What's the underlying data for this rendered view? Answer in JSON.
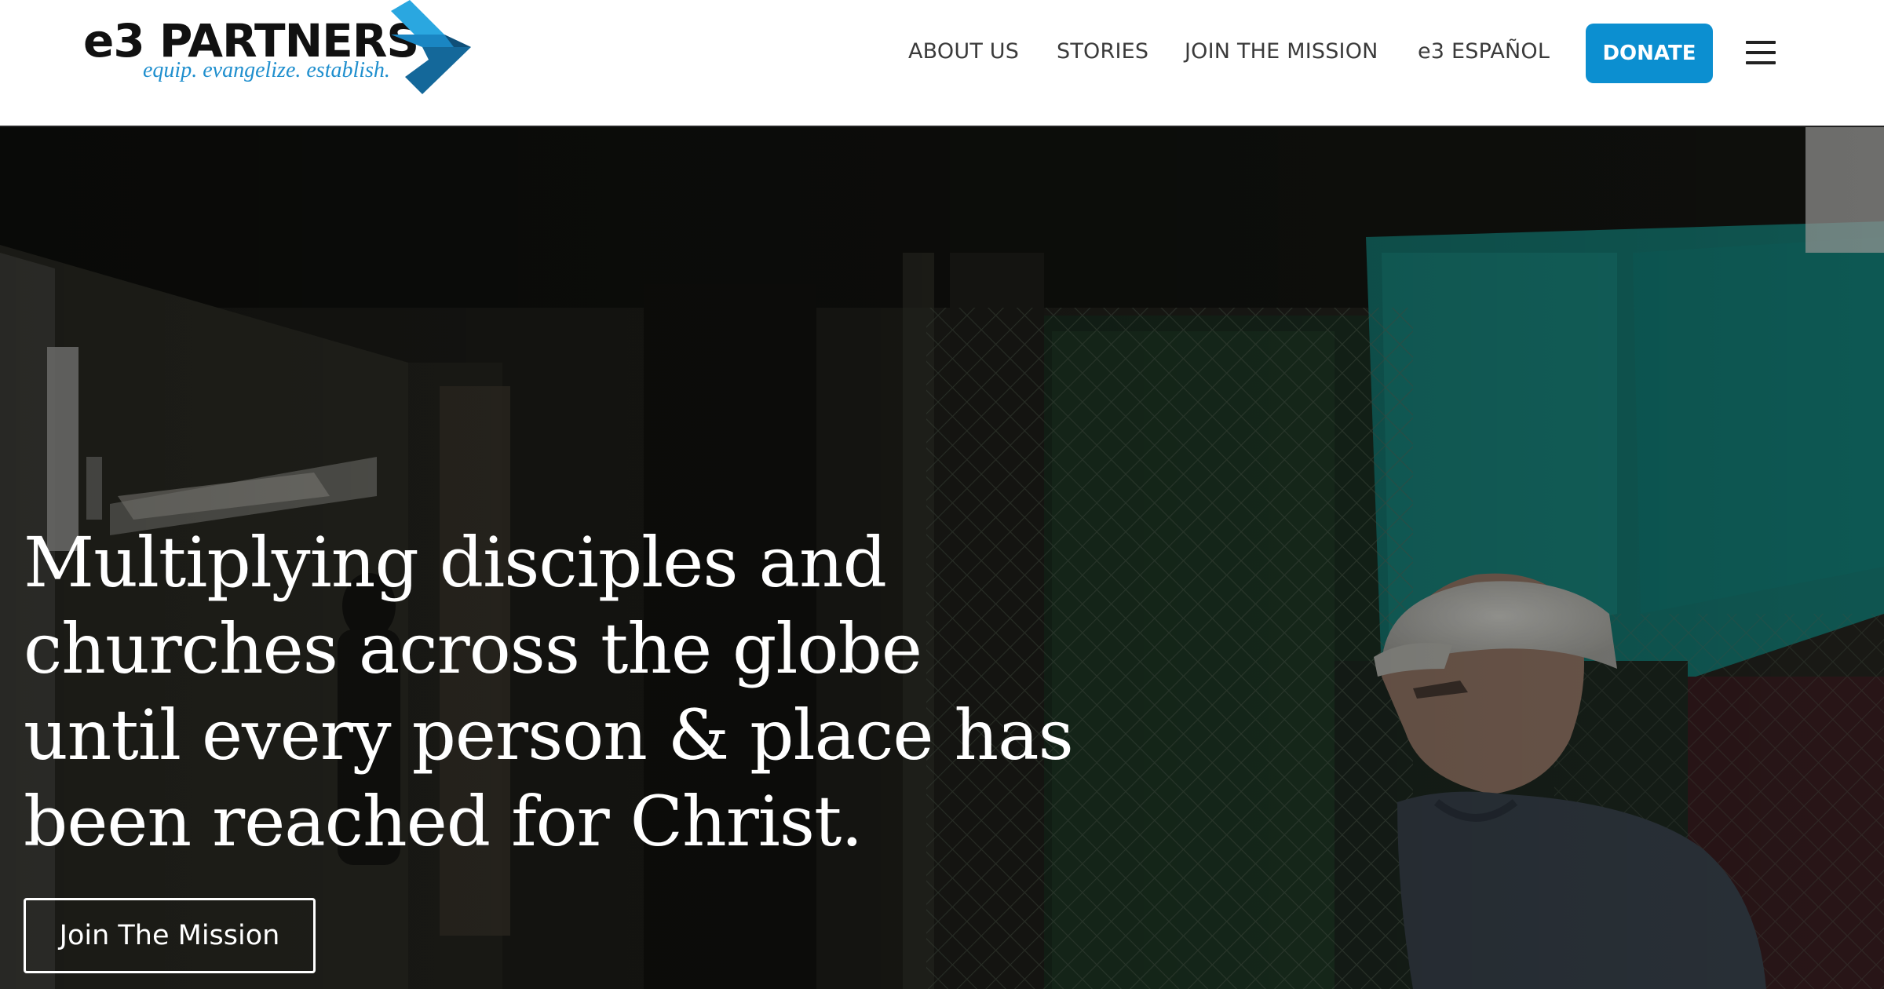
{
  "brand": {
    "name": "e3 PARTNERS",
    "tagline": "equip. evangelize. establish.",
    "colors": {
      "accent": "#0c8fd0",
      "mark_light": "#2aa7e0",
      "mark_dark": "#14689a"
    }
  },
  "nav": {
    "items": [
      {
        "label": "ABOUT US"
      },
      {
        "label": "STORIES"
      },
      {
        "label": "JOIN THE MISSION"
      },
      {
        "label": "e3 ESPAÑOL"
      }
    ],
    "donate_label": "DONATE",
    "menu_icon": "hamburger-menu-icon"
  },
  "hero": {
    "headline": "Multiplying disciples and churches across the globe until every person & place has been reached for Christ.",
    "cta_label": "Join The Mission"
  }
}
